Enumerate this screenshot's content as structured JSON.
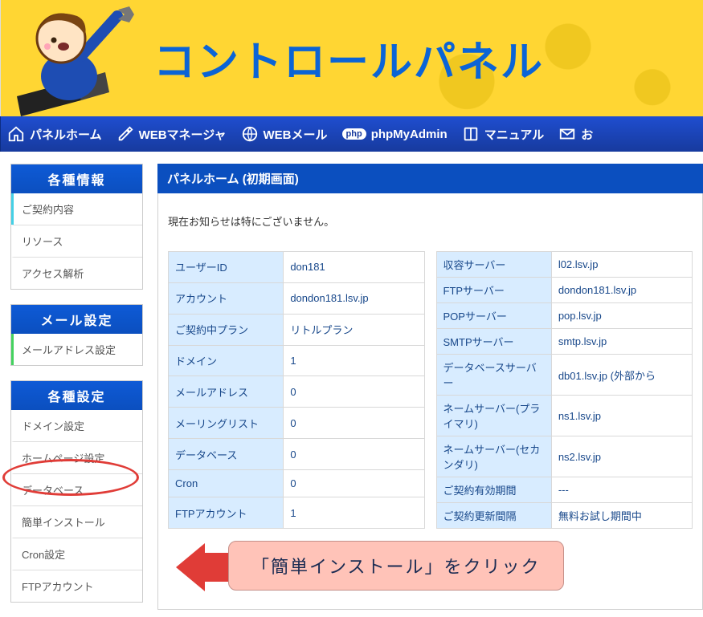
{
  "banner": {
    "title": "コントロールパネル"
  },
  "nav": {
    "home": "パネルホーム",
    "web_manager": "WEBマネージャ",
    "web_mail": "WEBメール",
    "php_badge": "php",
    "phpmyadmin": "phpMyAdmin",
    "manual": "マニュアル",
    "contact": "お"
  },
  "sidebar": {
    "sec1": {
      "title": "各種情報",
      "items": [
        "ご契約内容",
        "リソース",
        "アクセス解析"
      ]
    },
    "sec2": {
      "title": "メール設定",
      "items": [
        "メールアドレス設定"
      ]
    },
    "sec3": {
      "title": "各種設定",
      "items": [
        "ドメイン設定",
        "ホームページ設定",
        "データベース",
        "簡単インストール",
        "Cron設定",
        "FTPアカウント"
      ]
    }
  },
  "main": {
    "title": "パネルホーム (初期画面)",
    "notice": "現在お知らせは特にございません。",
    "left_rows": [
      {
        "k": "ユーザーID",
        "v": "don181"
      },
      {
        "k": "アカウント",
        "v": "dondon181.lsv.jp"
      },
      {
        "k": "ご契約中プラン",
        "v": "リトルプラン"
      },
      {
        "k": "ドメイン",
        "v": "1"
      },
      {
        "k": "メールアドレス",
        "v": "0"
      },
      {
        "k": "メーリングリスト",
        "v": "0"
      },
      {
        "k": "データベース",
        "v": "0"
      },
      {
        "k": "Cron",
        "v": "0"
      },
      {
        "k": "FTPアカウント",
        "v": "1"
      }
    ],
    "right_rows": [
      {
        "k": "収容サーバー",
        "v": "l02.lsv.jp"
      },
      {
        "k": "FTPサーバー",
        "v": "dondon181.lsv.jp"
      },
      {
        "k": "POPサーバー",
        "v": "pop.lsv.jp"
      },
      {
        "k": "SMTPサーバー",
        "v": "smtp.lsv.jp"
      },
      {
        "k": "データベースサーバー",
        "v": "db01.lsv.jp (外部から"
      },
      {
        "k": "ネームサーバー(プライマリ)",
        "v": "ns1.lsv.jp"
      },
      {
        "k": "ネームサーバー(セカンダリ)",
        "v": "ns2.lsv.jp"
      },
      {
        "k": "ご契約有効期間",
        "v": "---"
      },
      {
        "k": "ご契約更新間隔",
        "v": "無料お試し期間中"
      }
    ],
    "callout": "「簡単インストール」をクリック"
  }
}
